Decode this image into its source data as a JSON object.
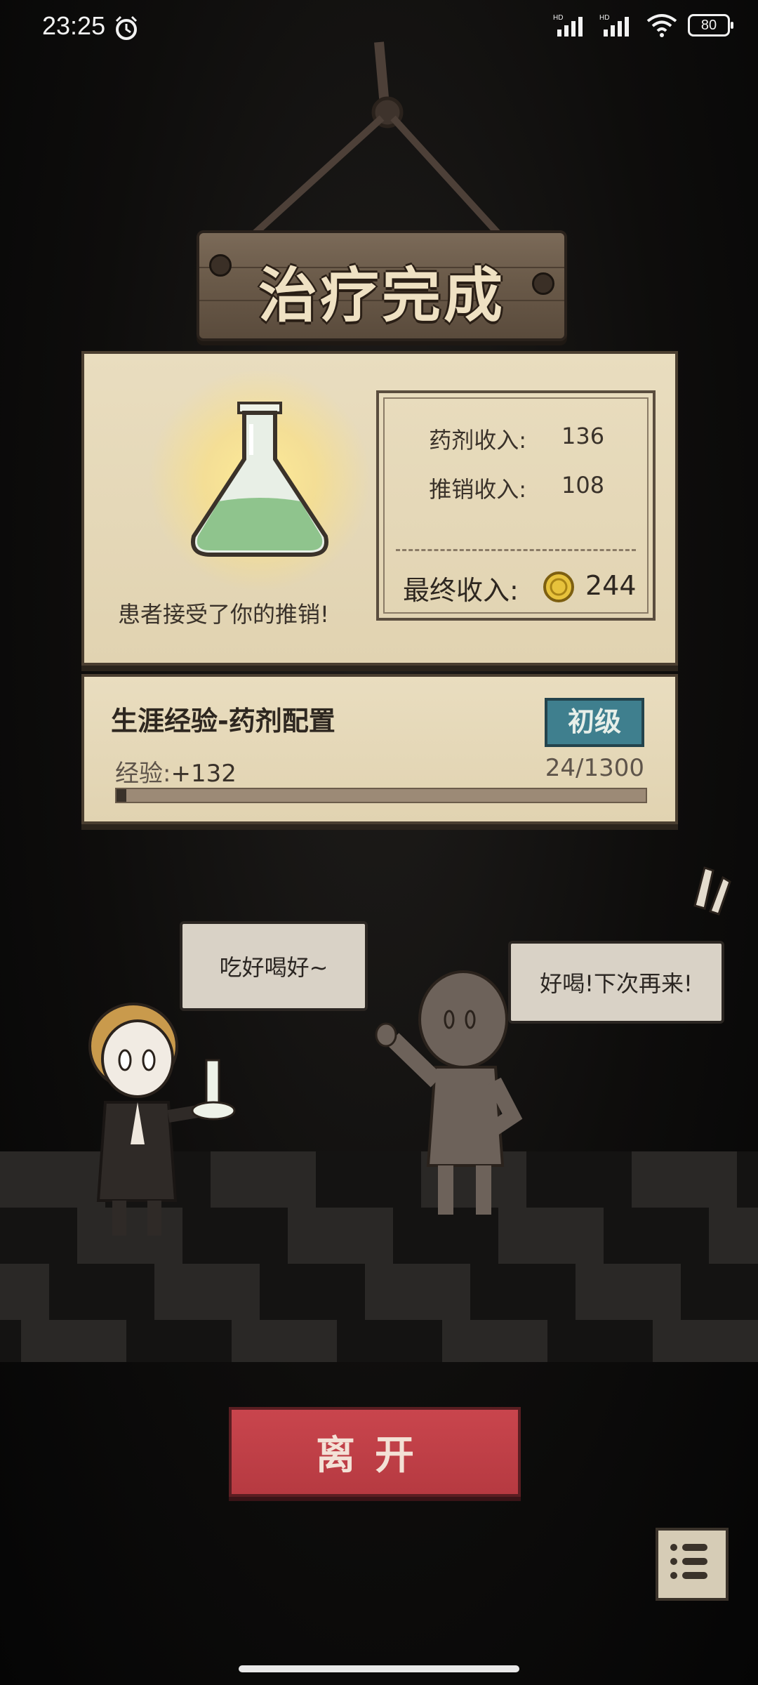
{
  "status_bar": {
    "time": "23:25",
    "battery": "80",
    "network_1": "HD",
    "network_2": "HD"
  },
  "sign": {
    "title": "治疗完成"
  },
  "result": {
    "patient_message": "患者接受了你的推销!",
    "potion_income_label": "药剂收入:",
    "potion_income_value": "136",
    "promo_income_label": "推销收入:",
    "promo_income_value": "108",
    "final_income_label": "最终收入:",
    "final_income_value": "244"
  },
  "experience": {
    "title": "生涯经验-药剂配置",
    "level": "初级",
    "gain_label": "经验:",
    "gain_value": "+132",
    "progress": "24/1300",
    "progress_fraction": 0.018
  },
  "scene": {
    "doctor_speech": "吃好喝好~",
    "patient_speech": "好喝!下次再来!"
  },
  "buttons": {
    "leave": "离开"
  },
  "colors": {
    "accent_red": "#b63a41",
    "badge_teal": "#3f7f8e",
    "parchment": "#e9ddbf"
  }
}
